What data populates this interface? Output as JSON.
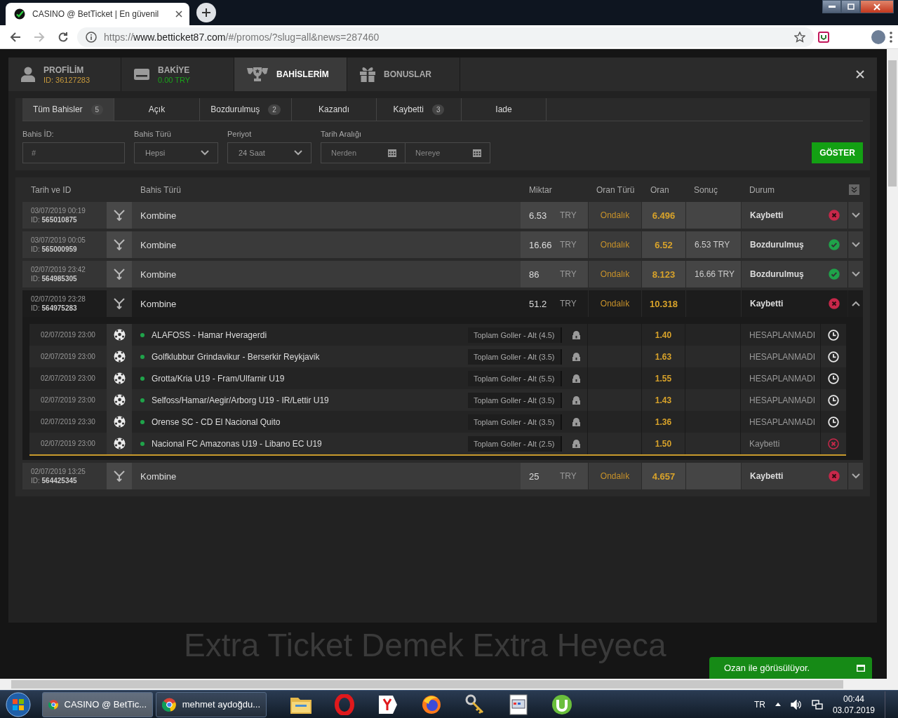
{
  "browser": {
    "tab_title": "CASINO @ BetTicket | En güvenil",
    "url_scheme": "https://",
    "url_host": "www.betticket87.com",
    "url_path": "/#/promos/?slug=all&news=287460"
  },
  "account_tabs": [
    {
      "kind": "profile",
      "label": "PROFİLİM",
      "sub": {
        "text": "ID: 36127283",
        "color": "#c89a3c"
      },
      "selected": false
    },
    {
      "kind": "balance",
      "label": "BAKİYE",
      "sub": {
        "text": "0.00 TRY",
        "color": "#1aa31a"
      },
      "selected": false
    },
    {
      "kind": "bets",
      "label": "BAHİSLERİM",
      "selected": true
    },
    {
      "kind": "bonus",
      "label": "BONUSLAR",
      "selected": false
    }
  ],
  "filter_tabs": [
    {
      "label": "Tüm Bahisler",
      "count": "5",
      "selected": true
    },
    {
      "label": "Açık",
      "selected": false
    },
    {
      "label": "Bozdurulmuş",
      "count": "2",
      "selected": false
    },
    {
      "label": "Kazandı",
      "selected": false
    },
    {
      "label": "Kaybetti",
      "count": "3",
      "selected": false
    },
    {
      "label": "Iade",
      "selected": false
    }
  ],
  "filters": [
    {
      "kind": "text",
      "label": "Bahis İD:",
      "placeholder": "#"
    },
    {
      "kind": "select",
      "label": "Bahis Türü",
      "value": "Hepsi"
    },
    {
      "kind": "select",
      "label": "Periyot",
      "value": "24 Saat"
    },
    {
      "kind": "daterange",
      "label": "Tarih Aralığı",
      "from_placeholder": "Nerden",
      "to_placeholder": "Nereye"
    }
  ],
  "show_button": "GÖSTER",
  "columns": [
    "Tarih ve ID",
    "Bahis Türü",
    "Miktar",
    "Oran Türü",
    "Oran",
    "Sonuç",
    "Durum"
  ],
  "bets": [
    {
      "date": "03/07/2019 00:19",
      "id": "ID: **565010875**",
      "type": "Kombine",
      "amount": "6.53",
      "currency": "TRY",
      "odds_type": "Ondalık",
      "odds": "6.496",
      "status": "Kaybetti",
      "kind": "lost",
      "expanded": false
    },
    {
      "date": "03/07/2019 00:05",
      "id": "ID: **565000959**",
      "type": "Kombine",
      "amount": "16.66",
      "currency": "TRY",
      "odds_type": "Ondalık",
      "odds": "6.52",
      "result": "6.53 TRY",
      "status": "Bozdurulmuş",
      "kind": "cashout",
      "expanded": false
    },
    {
      "date": "02/07/2019 23:42",
      "id": "ID: **564985305**",
      "type": "Kombine",
      "amount": "86",
      "currency": "TRY",
      "odds_type": "Ondalık",
      "odds": "8.123",
      "result": "16.66 TRY",
      "status": "Bozdurulmuş",
      "kind": "cashout",
      "expanded": false
    },
    {
      "date": "02/07/2019 23:28",
      "id": "ID: **564975283**",
      "type": "Kombine",
      "amount": "51.2",
      "currency": "TRY",
      "odds_type": "Ondalık",
      "odds": "10.318",
      "status": "Kaybetti",
      "kind": "lost",
      "expanded": true,
      "selections": [
        {
          "date": "02/07/2019 23:00",
          "match": "ALAFOSS - Hamar Hveragerdi",
          "market": "Toplam Goller - Alt (4.5)",
          "odds": "1.40",
          "status": "HESAPLANMADI",
          "kind": "pending"
        },
        {
          "date": "02/07/2019 23:00",
          "match": "Golfklubbur Grindavikur - Berserkir Reykjavik",
          "market": "Toplam Goller - Alt (3.5)",
          "odds": "1.63",
          "status": "HESAPLANMADI",
          "kind": "pending"
        },
        {
          "date": "02/07/2019 23:00",
          "match": "Grotta/Kria U19 - Fram/Ulfarnir U19",
          "market": "Toplam Goller - Alt (5.5)",
          "odds": "1.55",
          "status": "HESAPLANMADI",
          "kind": "pending"
        },
        {
          "date": "02/07/2019 23:00",
          "match": "Selfoss/Hamar/Aegir/Arborg U19 - IR/Lettir U19",
          "market": "Toplam Goller - Alt (3.5)",
          "odds": "1.43",
          "status": "HESAPLANMADI",
          "kind": "pending"
        },
        {
          "date": "02/07/2019 23:30",
          "match": "Orense SC - CD El Nacional Quito",
          "market": "Toplam Goller - Alt (3.5)",
          "odds": "1.36",
          "status": "HESAPLANMADI",
          "kind": "pending"
        },
        {
          "date": "02/07/2019 23:00",
          "match": "Nacional FC Amazonas U19 - Libano EC U19",
          "market": "Toplam Goller - Alt (2.5)",
          "odds": "1.50",
          "status": "Kaybetti",
          "kind": "lost"
        }
      ]
    },
    {
      "date": "02/07/2019 13:25",
      "id": "ID: **564425345**",
      "type": "Kombine",
      "amount": "25",
      "currency": "TRY",
      "odds_type": "Ondalık",
      "odds": "4.657",
      "status": "Kaybetti",
      "kind": "lost",
      "expanded": false
    }
  ],
  "banner": "Extra Ticket Demek Extra Heyeca",
  "chat": {
    "label": "Ozan ile görüsülüyor."
  },
  "taskbar": {
    "windows": [
      {
        "label": "CASINO @ BetTic...",
        "selected": true
      },
      {
        "label": "mehmet aydoğdu...",
        "selected": false
      }
    ],
    "pinned": [
      {
        "kind": "folder"
      },
      {
        "kind": "ring"
      },
      {
        "kind": "shield"
      },
      {
        "kind": "globe"
      },
      {
        "kind": "key"
      },
      {
        "kind": "window"
      },
      {
        "kind": "round"
      }
    ],
    "language": "TR",
    "time": "00:44",
    "date": "03.07.2019"
  }
}
